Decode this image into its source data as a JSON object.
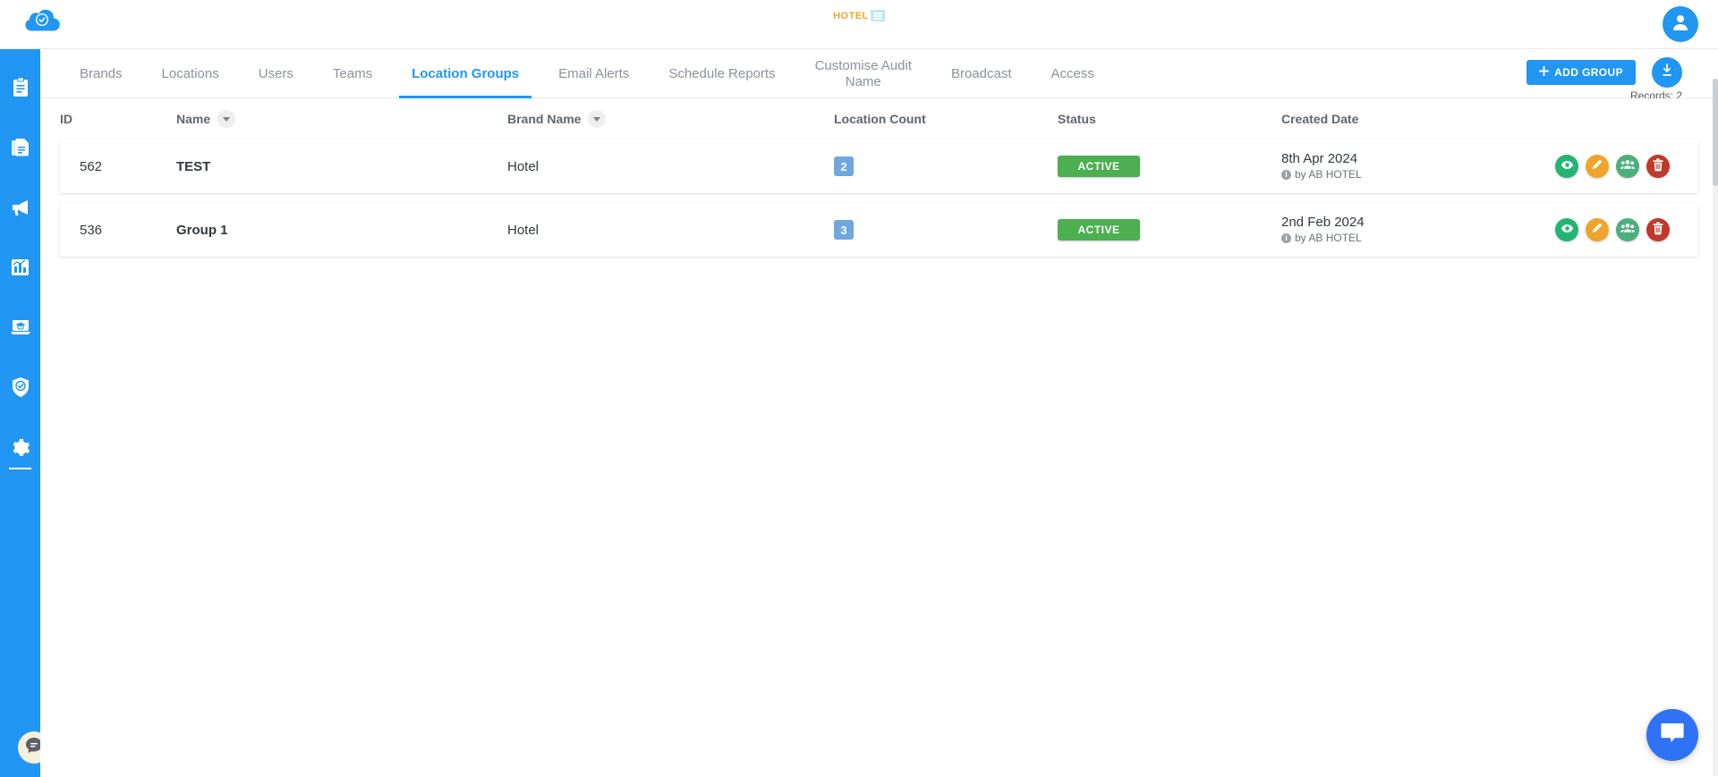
{
  "header": {
    "logo_icon": "cloud-check-icon",
    "center_logo_word": "HOTEL",
    "center_logo_mark": "grid-mark-icon",
    "avatar_icon": "user-avatar-icon"
  },
  "sidebar": {
    "items": [
      {
        "icon": "dashboard-grid-icon",
        "name": "dashboard",
        "active": false
      },
      {
        "icon": "clipboard-icon",
        "name": "audits",
        "active": false
      },
      {
        "icon": "documents-icon",
        "name": "reports",
        "active": false
      },
      {
        "icon": "megaphone-icon",
        "name": "broadcast",
        "active": false
      },
      {
        "icon": "bar-chart-icon",
        "name": "analytics",
        "active": false
      },
      {
        "icon": "elearning-icon",
        "name": "elearning",
        "active": false
      },
      {
        "icon": "shield-check-icon",
        "name": "compliance",
        "active": false
      },
      {
        "icon": "gear-icon",
        "name": "settings",
        "active": true
      }
    ],
    "chat_icon": "chat-bubble-icon"
  },
  "tabs": [
    {
      "label": "Brands",
      "active": false
    },
    {
      "label": "Locations",
      "active": false
    },
    {
      "label": "Users",
      "active": false
    },
    {
      "label": "Teams",
      "active": false
    },
    {
      "label": "Location Groups",
      "active": true
    },
    {
      "label": "Email Alerts",
      "active": false
    },
    {
      "label": "Schedule Reports",
      "active": false
    },
    {
      "label": "Customise Audit\nName",
      "active": false
    },
    {
      "label": "Broadcast",
      "active": false
    },
    {
      "label": "Access",
      "active": false
    }
  ],
  "toolbar": {
    "add_group_label": "ADD GROUP",
    "add_icon": "plus-icon",
    "download_icon": "download-icon",
    "records_label": "Records: 2"
  },
  "table": {
    "columns": {
      "id": "ID",
      "name": "Name",
      "brand": "Brand Name",
      "count": "Location Count",
      "status": "Status",
      "date": "Created Date"
    },
    "rows": [
      {
        "id": "562",
        "name": "TEST",
        "brand": "Hotel",
        "count": "2",
        "status": "ACTIVE",
        "date": "8th Apr 2024",
        "author": "by AB HOTEL"
      },
      {
        "id": "536",
        "name": "Group 1",
        "brand": "Hotel",
        "count": "3",
        "status": "ACTIVE",
        "date": "2nd Feb 2024",
        "author": "by AB HOTEL"
      }
    ],
    "actions": [
      {
        "name": "view",
        "icon": "eye-icon"
      },
      {
        "name": "edit",
        "icon": "pencil-icon"
      },
      {
        "name": "assign-users",
        "icon": "people-icon"
      },
      {
        "name": "delete",
        "icon": "trash-icon"
      }
    ]
  },
  "chat_widget": {
    "icon": "chat-bubble-icon"
  },
  "colors": {
    "accent": "#2196f3",
    "status_active": "#4caf50",
    "badge": "#6fa8e0",
    "logo_word": "#f5a623",
    "action_view": "#22b573",
    "action_edit": "#f0a42b",
    "action_team": "#4caf7d",
    "action_delete": "#c0392b"
  }
}
